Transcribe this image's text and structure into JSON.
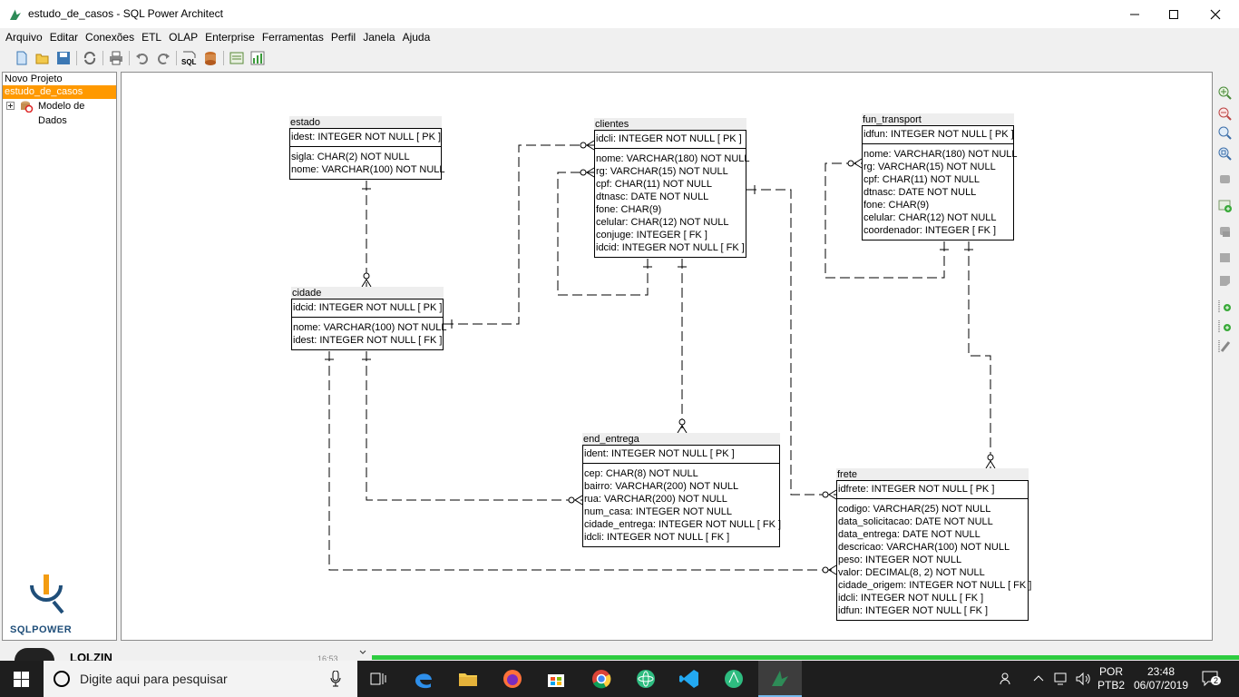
{
  "window": {
    "title": "estudo_de_casos - SQL Power Architect"
  },
  "menu": [
    "Arquivo",
    "Editar",
    "Conexões",
    "ETL",
    "OLAP",
    "Enterprise",
    "Ferramentas",
    "Perfil",
    "Janela",
    "Ajuda"
  ],
  "toolbar": {
    "icons": [
      "new-project-icon",
      "open-icon",
      "save-icon",
      "refresh-icon",
      "print-icon",
      "undo-icon",
      "redo-icon",
      "sql-icon",
      "compare-icon",
      "export-icon",
      "profile-icon"
    ],
    "sql_label": "SQL"
  },
  "tree": {
    "header": "Novo Projeto",
    "selected": "estudo_de_casos",
    "item": "Modelo de Dados"
  },
  "logo": {
    "text": "SQLPOWER"
  },
  "tables": [
    {
      "name": "estado",
      "pk": [
        "idest: INTEGER   NOT NULL  [ PK ]"
      ],
      "cols": [
        "sigla: CHAR(2)   NOT NULL",
        "nome: VARCHAR(100)   NOT NULL"
      ]
    },
    {
      "name": "clientes",
      "pk": [
        "idcli: INTEGER   NOT NULL  [ PK ]"
      ],
      "cols": [
        "nome: VARCHAR(180)   NOT NULL",
        "rg: VARCHAR(15)   NOT NULL",
        "cpf: CHAR(11)   NOT NULL",
        "dtnasc: DATE   NOT NULL",
        "fone: CHAR(9)",
        "celular: CHAR(12)   NOT NULL",
        "conjuge: INTEGER  [ FK ]",
        "idcid: INTEGER   NOT NULL  [ FK ]"
      ]
    },
    {
      "name": "fun_transport",
      "pk": [
        "idfun: INTEGER   NOT NULL  [ PK ]"
      ],
      "cols": [
        "nome: VARCHAR(180)   NOT NULL",
        "rg: VARCHAR(15)   NOT NULL",
        "cpf: CHAR(11)   NOT NULL",
        "dtnasc: DATE   NOT NULL",
        "fone: CHAR(9)",
        "celular: CHAR(12)   NOT NULL",
        "coordenador: INTEGER  [ FK ]"
      ]
    },
    {
      "name": "cidade",
      "pk": [
        "idcid: INTEGER   NOT NULL  [ PK ]"
      ],
      "cols": [
        "nome: VARCHAR(100)   NOT NULL",
        "idest: INTEGER   NOT NULL  [ FK ]"
      ]
    },
    {
      "name": "end_entrega",
      "pk": [
        "ident: INTEGER   NOT NULL  [ PK ]"
      ],
      "cols": [
        "cep: CHAR(8)   NOT NULL",
        "bairro: VARCHAR(200)   NOT NULL",
        "rua: VARCHAR(200)   NOT NULL",
        "num_casa: INTEGER   NOT NULL",
        "cidade_entrega: INTEGER   NOT NULL  [ FK ]",
        "idcli: INTEGER   NOT NULL  [ FK ]"
      ]
    },
    {
      "name": "frete",
      "pk": [
        "idfrete: INTEGER   NOT NULL  [ PK ]"
      ],
      "cols": [
        "codigo: VARCHAR(25)   NOT NULL",
        "data_solicitacao: DATE   NOT NULL",
        "data_entrega: DATE   NOT NULL",
        "descricao: VARCHAR(100)   NOT NULL",
        "peso: INTEGER   NOT NULL",
        "valor: DECIMAL(8, 2)   NOT NULL",
        "cidade_origem: INTEGER   NOT NULL  [ FK ]",
        "idcli: INTEGER   NOT NULL  [ FK ]",
        "idfun: INTEGER   NOT NULL  [ FK ]"
      ]
    }
  ],
  "background_window": {
    "partial_text": "LOLZIN",
    "time": "16:53"
  },
  "taskbar": {
    "search_placeholder": "Digite aqui para pesquisar",
    "language": "POR",
    "layout": "PTB2",
    "time": "23:48",
    "date": "06/07/2019",
    "notification_count": "2"
  },
  "colors": {
    "selection": "#ff9900",
    "taskbar": "#1e1e1e",
    "accent": "#0078d7"
  }
}
